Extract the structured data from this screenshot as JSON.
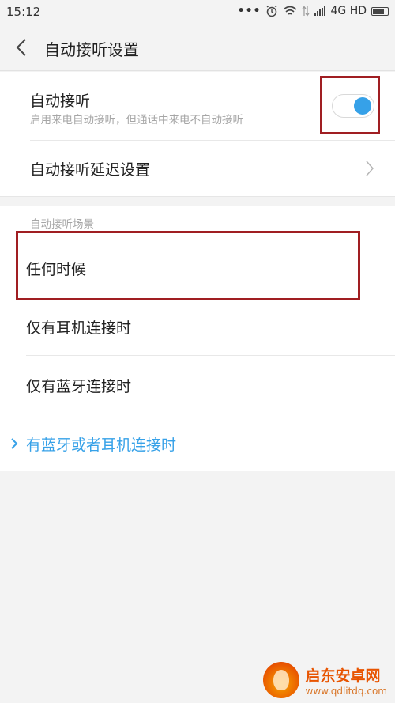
{
  "status_bar": {
    "time": "15:12",
    "dots": "•••",
    "network": "4G HD",
    "icons": [
      "alarm-icon",
      "wifi-icon",
      "signal-icon",
      "battery-icon"
    ]
  },
  "header": {
    "title": "自动接听设置"
  },
  "auto_answer": {
    "title": "自动接听",
    "subtitle": "启用来电自动接听，但通话中来电不自动接听",
    "enabled": true
  },
  "delay": {
    "label": "自动接听延迟设置"
  },
  "scenarios": {
    "section_title": "自动接听场景",
    "options": [
      {
        "label": "任何时候",
        "selected": false
      },
      {
        "label": "仅有耳机连接时",
        "selected": false
      },
      {
        "label": "仅有蓝牙连接时",
        "selected": false
      },
      {
        "label": "有蓝牙或者耳机连接时",
        "selected": true
      }
    ]
  },
  "watermark": {
    "name": "启东安卓网",
    "url": "www.qdlitdq.com"
  },
  "colors": {
    "accent": "#36a1e8",
    "highlight_box": "#a01e22",
    "background": "#f3f3f3"
  }
}
